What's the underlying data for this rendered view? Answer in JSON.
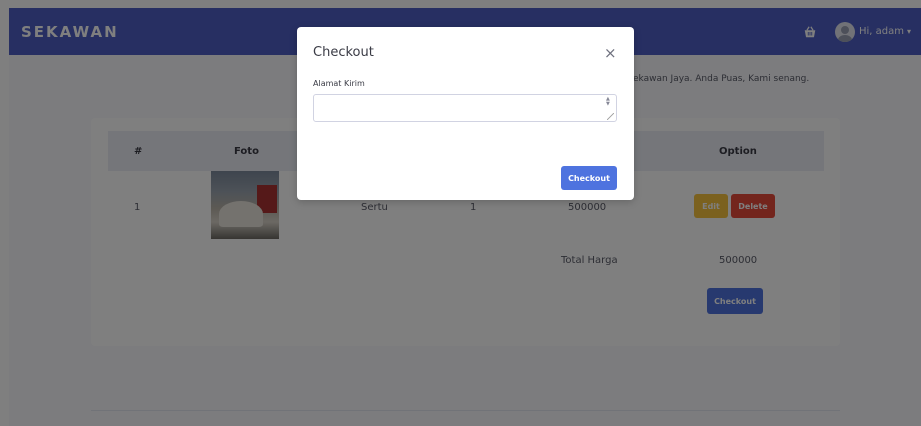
{
  "navbar": {
    "brand": "SEKAWAN",
    "user_greeting": "Hi, adam",
    "caret": "▾"
  },
  "marquee": {
    "text": "ekawan Jaya. Anda Puas, Kami senang."
  },
  "table": {
    "headers": {
      "num": "#",
      "photo": "Foto",
      "option": "Option"
    },
    "rows": [
      {
        "num": "1",
        "name": "Sertu",
        "qty": "1",
        "price": "500000",
        "edit_label": "Edit",
        "delete_label": "Delete"
      }
    ],
    "total_label": "Total Harga",
    "total_value": "500000",
    "checkout_label": "Checkout"
  },
  "modal": {
    "title": "Checkout",
    "close_glyph": "×",
    "address_label": "Alamat Kirim",
    "address_value": "",
    "submit_label": "Checkout"
  },
  "colors": {
    "navbar": "#4e5ec4",
    "primary": "#4e73df",
    "warning": "#f6c23e",
    "danger": "#e74a3b"
  },
  "icons": {
    "cart": "basket-icon",
    "user": "user-avatar-icon",
    "close": "close-icon"
  }
}
